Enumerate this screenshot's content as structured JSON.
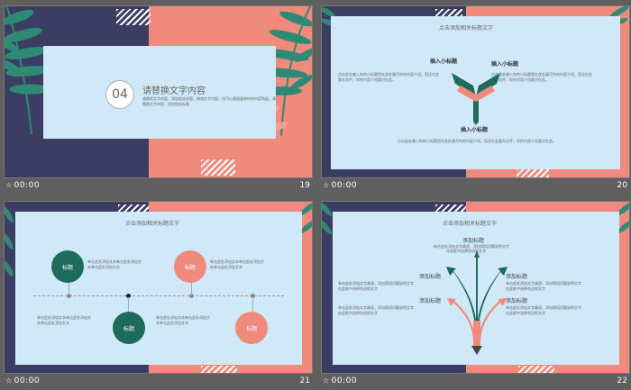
{
  "slides": [
    {
      "time": "00:00",
      "number": "19",
      "section_num": "04",
      "section_title": "请替换文字内容",
      "section_desc_1": "请替换文字内容，添加相关标题，修改文字内容，也可以直接复制你的内容到此。请",
      "section_desc_2": "替换文字内容，添加相关标题"
    },
    {
      "time": "00:00",
      "number": "20",
      "title": "点击添加相关标题文字",
      "label_left": "插入小标题",
      "label_right": "插入小标题",
      "label_bottom": "插入小标题",
      "text_left_1": "点击此处输入你的小标题您在此处填写你的内容介绍。您还在此",
      "text_left_2": "要存文件，你的内容介绍要对在此。",
      "text_right_1": "点击此处输入你的小标题您在此处填写你的内容介绍。您还在此",
      "text_right_2": "要存文件，你的内容介绍要对在此。",
      "text_bottom_1": "点击此处输入你的小标题您在此处填写你的内容介绍。您还在此要存文件，你的内容介绍要对在此。"
    },
    {
      "time": "00:00",
      "number": "21",
      "title": "点击添加相关标题文字",
      "circle_label": "标题",
      "text_a_1": "单击此处添加文本单击此处添加文",
      "text_a_2": "本单击此处添加文本",
      "text_b_1": "单击此处添加文本单击此处添加文",
      "text_b_2": "本单击此处添加文本"
    },
    {
      "time": "00:00",
      "number": "22",
      "title": "点击添加相关标题文字",
      "heading": "添加标题",
      "text_1": "单击此处添加文字阐述，添加简短问题说明文字",
      "text_2": "单击此处添加文字阐述，添加简短问题说明文字",
      "text_3": "在此框中选择合适的文字",
      "text_4": "在此框中选择合适的文字"
    }
  ],
  "colors": {
    "navy": "#3b3e62",
    "coral": "#f08a7c",
    "panel": "#cfe9f8",
    "teal": "#1e6b5c"
  }
}
